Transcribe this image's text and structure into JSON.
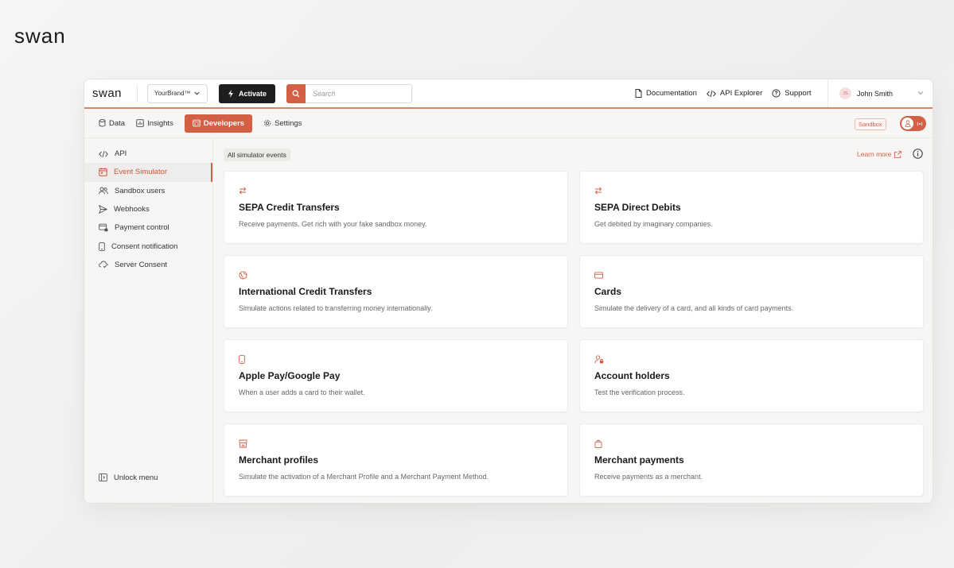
{
  "brand": {
    "logo": "swan"
  },
  "topbar": {
    "app_logo": "swan",
    "brand_select": "YourBrand™",
    "activate_label": "Activate",
    "search_placeholder": "Search",
    "links": {
      "documentation": "Documentation",
      "api_explorer": "API Explorer",
      "support": "Support"
    },
    "user": {
      "initials": "JS",
      "name": "John Smith"
    }
  },
  "nav": {
    "tabs": {
      "data": "Data",
      "insights": "Insights",
      "developers": "Developers",
      "settings": "Settings"
    },
    "sandbox_badge": "Sandbox",
    "active_tab": "Developers"
  },
  "sidebar": {
    "items": [
      {
        "label": "API",
        "icon": "code-icon"
      },
      {
        "label": "Event Simulator",
        "icon": "calendar-icon",
        "active": true
      },
      {
        "label": "Sandbox users",
        "icon": "users-icon"
      },
      {
        "label": "Webhooks",
        "icon": "send-icon"
      },
      {
        "label": "Payment control",
        "icon": "card-lock-icon"
      },
      {
        "label": "Consent notification",
        "icon": "phone-icon"
      },
      {
        "label": "Server Consent",
        "icon": "cloud-check-icon"
      }
    ],
    "unlock_menu": "Unlock menu"
  },
  "main": {
    "breadcrumb": "All simulator events",
    "learn_more": "Learn more",
    "cards": [
      {
        "title": "SEPA Credit Transfers",
        "description": "Receive payments. Get rich with your fake sandbox money.",
        "icon": "arrows-exchange-icon"
      },
      {
        "title": "SEPA Direct Debits",
        "description": "Get debited by imaginary companies.",
        "icon": "arrows-exchange-icon"
      },
      {
        "title": "International Credit Transfers",
        "description": "Simulate actions related to transferring money internationally.",
        "icon": "globe-icon"
      },
      {
        "title": "Cards",
        "description": "Simulate the delivery of a card, and all kinds of card payments.",
        "icon": "credit-card-icon"
      },
      {
        "title": "Apple Pay/Google Pay",
        "description": "When a user adds a card to their wallet.",
        "icon": "smartphone-icon"
      },
      {
        "title": "Account holders",
        "description": "Test the verification process.",
        "icon": "person-lock-icon"
      },
      {
        "title": "Merchant profiles",
        "description": "Simulate the activation of a Merchant Profile and a Merchant Payment Method.",
        "icon": "store-icon"
      },
      {
        "title": "Merchant payments",
        "description": "Receive payments as a merchant.",
        "icon": "bag-icon"
      }
    ]
  },
  "colors": {
    "accent": "#d35f45",
    "dark_button": "#1e1e1e",
    "background": "#f7f6f5"
  }
}
